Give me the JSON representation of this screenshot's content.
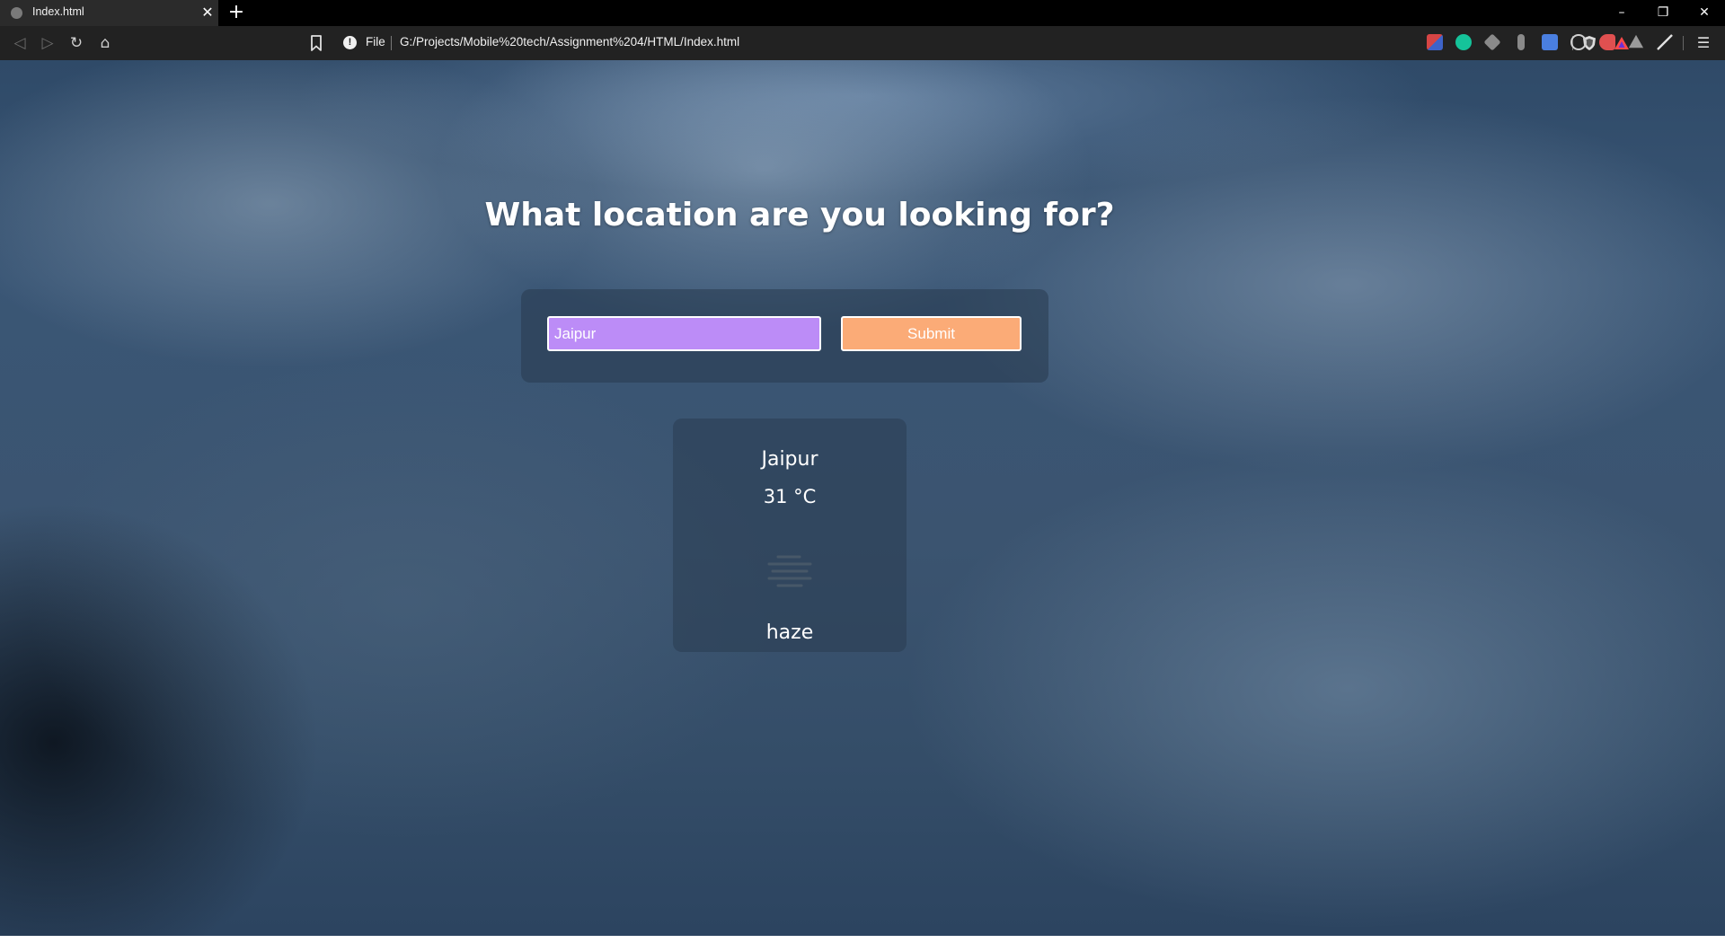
{
  "browser": {
    "tab_title": "Index.html",
    "tab_close": "✕",
    "new_tab": "+",
    "window_controls": {
      "minimize": "–",
      "restore": "❐",
      "close": "✕"
    },
    "nav": {
      "back": "◁",
      "forward": "▷",
      "reload": "↻",
      "home": "⌂"
    },
    "address": {
      "scheme_label": "File",
      "url": "G:/Projects/Mobile%20tech/Assignment%204/HTML/Index.html"
    },
    "menu": "☰",
    "extensions": [
      {
        "icon": "flag-extension-icon",
        "color": "#d64545"
      },
      {
        "icon": "grammarly-icon",
        "color": "#15c39a"
      },
      {
        "icon": "layers-extension-icon",
        "color": "#8a8a8a"
      },
      {
        "icon": "dots-extension-icon",
        "color": "#8a8a8a"
      },
      {
        "icon": "translate-icon",
        "color": "#4a7fe0"
      },
      {
        "icon": "react-devtools-icon",
        "color": "#61dafb"
      },
      {
        "icon": "video-extension-icon",
        "color": "#e05050"
      },
      {
        "icon": "drive-icon",
        "color": "#9a9a9a"
      },
      {
        "icon": "pen-extension-icon",
        "color": "#cccccc"
      }
    ]
  },
  "page": {
    "heading": "What location are you looking for?",
    "form": {
      "city_value": "Jaipur",
      "submit_label": "Submit"
    },
    "weather": {
      "city": "Jaipur",
      "temperature": "31 °C",
      "icon": "haze-icon",
      "description": "haze"
    },
    "colors": {
      "input_bg": "#bc8cf7",
      "submit_bg": "#fbab77"
    }
  }
}
